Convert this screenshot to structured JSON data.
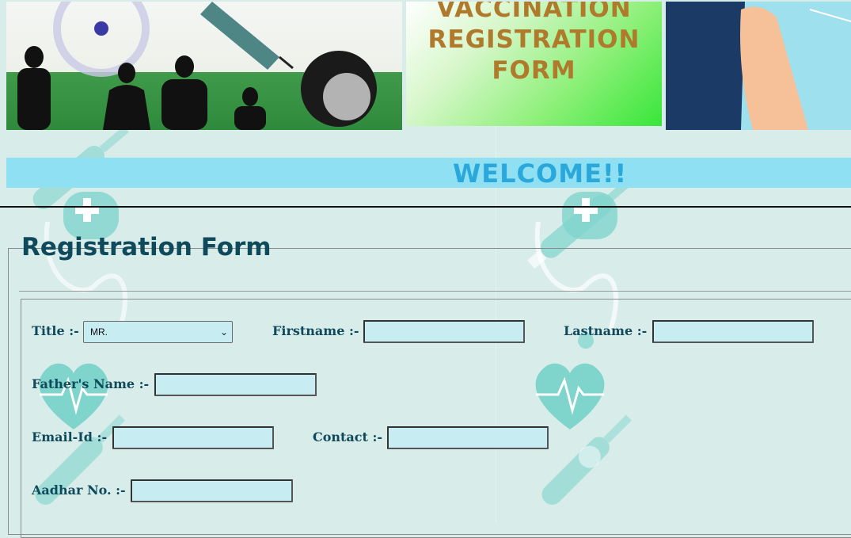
{
  "banner": {
    "title_line1": "VACCINATION",
    "title_line2": "REGISTRATION",
    "title_line3": "FORM"
  },
  "welcome": "WELCOME!!",
  "form": {
    "legend": "Registration Form",
    "title_label": "Title :-",
    "title_value": "MR.",
    "firstname_label": "Firstname :-",
    "firstname_value": "",
    "lastname_label": "Lastname :-",
    "lastname_value": "",
    "father_label": "Father's Name :-",
    "father_value": "",
    "email_label": "Email-Id :-",
    "email_value": "",
    "contact_label": "Contact :-",
    "contact_value": "",
    "aadhar_label": "Aadhar No. :-",
    "aadhar_value": ""
  },
  "colors": {
    "label": "#0f4a5c",
    "input_bg": "#c7ecf2",
    "welcome_bar": "#8fe0f2",
    "welcome_text": "#2aa8dc",
    "banner_title": "#b07a2c"
  },
  "icons": [
    "chevron-down-icon",
    "heart-pulse-icon",
    "syringe-icon",
    "stethoscope-icon"
  ]
}
